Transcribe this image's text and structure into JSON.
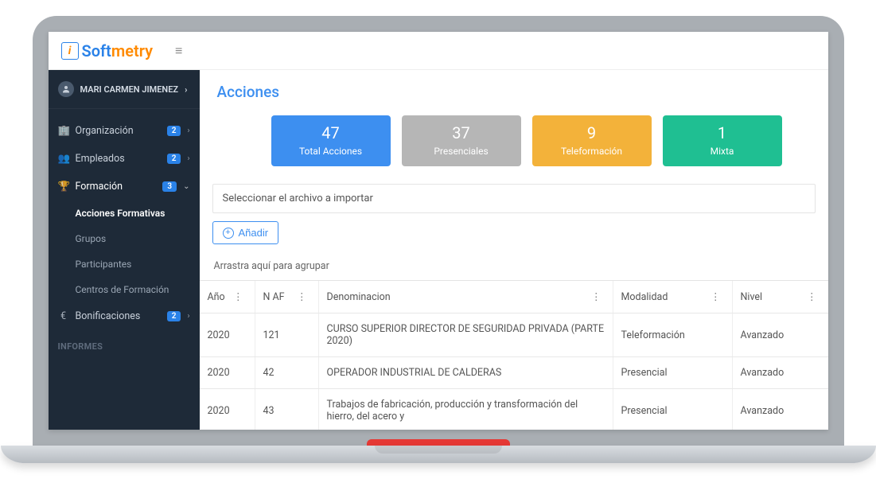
{
  "brand": {
    "soft": "Soft",
    "metry": "metry"
  },
  "user": {
    "name": "MARI CARMEN JIMENEZ"
  },
  "sidebar": {
    "items": [
      {
        "label": "Organización",
        "badge": "2",
        "icon": "🏢"
      },
      {
        "label": "Empleados",
        "badge": "2",
        "icon": "👥"
      },
      {
        "label": "Formación",
        "badge": "3",
        "icon": "🏆",
        "expanded": true,
        "children": [
          {
            "label": "Acciones Formativas",
            "active": true
          },
          {
            "label": "Grupos"
          },
          {
            "label": "Participantes"
          },
          {
            "label": "Centros de Formación"
          }
        ]
      },
      {
        "label": "Bonificaciones",
        "badge": "2",
        "icon": "€"
      }
    ],
    "section_label": "INFORMES"
  },
  "page": {
    "title": "Acciones",
    "stats": [
      {
        "num": "47",
        "lbl": "Total Acciones",
        "cls": "total"
      },
      {
        "num": "37",
        "lbl": "Presenciales",
        "cls": "pres"
      },
      {
        "num": "9",
        "lbl": "Teleformación",
        "cls": "tele"
      },
      {
        "num": "1",
        "lbl": "Mixta",
        "cls": "mixta"
      }
    ],
    "file_placeholder": "Seleccionar el archivo a importar",
    "add_label": "Añadir",
    "group_hint": "Arrastra aquí para agrupar",
    "columns": {
      "year": "Año",
      "naf": "N AF",
      "denom": "Denominacion",
      "mod": "Modalidad",
      "nivel": "Nivel"
    },
    "rows": [
      {
        "year": "2020",
        "naf": "121",
        "denom": "CURSO SUPERIOR DIRECTOR DE SEGURIDAD PRIVADA (PARTE 2020)",
        "mod": "Teleformación",
        "nivel": "Avanzado"
      },
      {
        "year": "2020",
        "naf": "42",
        "denom": "OPERADOR INDUSTRIAL DE CALDERAS",
        "mod": "Presencial",
        "nivel": "Avanzado"
      },
      {
        "year": "2020",
        "naf": "43",
        "denom": "Trabajos de fabricación, producción y transformación del hierro, del acero y",
        "mod": "Presencial",
        "nivel": "Avanzado"
      }
    ]
  }
}
